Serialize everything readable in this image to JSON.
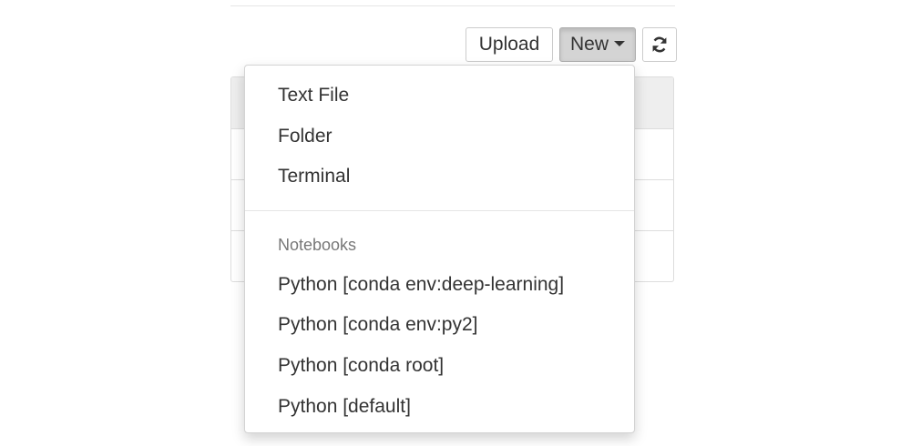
{
  "toolbar": {
    "upload_label": "Upload",
    "new_label": "New",
    "refresh_icon": "refresh-icon"
  },
  "menu": {
    "items": [
      {
        "label": "Text File"
      },
      {
        "label": "Folder"
      },
      {
        "label": "Terminal"
      }
    ],
    "notebooks_header": "Notebooks",
    "notebooks": [
      {
        "label": "Python [conda env:deep-learning]"
      },
      {
        "label": "Python [conda env:py2]"
      },
      {
        "label": "Python [conda root]"
      },
      {
        "label": "Python [default]"
      }
    ]
  }
}
